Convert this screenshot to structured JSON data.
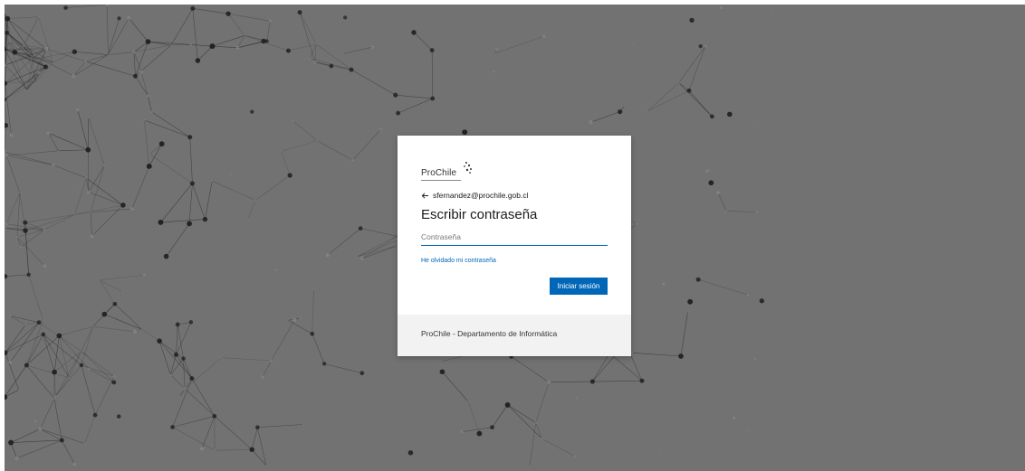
{
  "window": {
    "background_color": "#727272"
  },
  "brand": {
    "name": "ProChile",
    "logo_icon": "prochile-dots-logo",
    "accent_color": "#0067b8"
  },
  "identity": {
    "back_icon": "back-arrow-icon",
    "email": "sfernandez@prochile.gob.cl"
  },
  "form": {
    "title": "Escribir contraseña",
    "password": {
      "value": "",
      "placeholder": "Contraseña"
    },
    "forgot_link": "He olvidado mi contraseña",
    "submit_label": "Iniciar sesión"
  },
  "footer": {
    "text": "ProChile - Departamento de Informática"
  }
}
